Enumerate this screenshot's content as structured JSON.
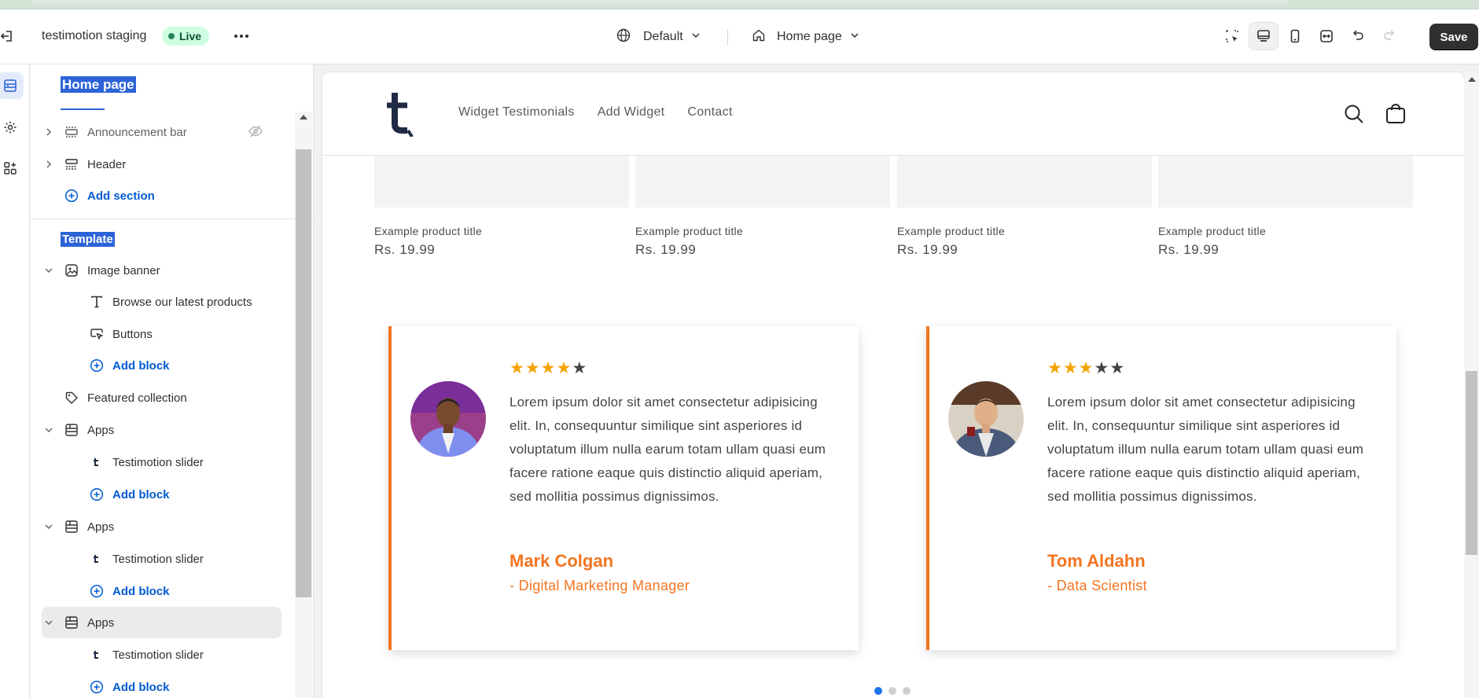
{
  "topbar": {
    "store_name": "testimotion staging",
    "status_badge": "Live",
    "theme_selector": "Default",
    "page_selector": "Home page",
    "save_label": "Save"
  },
  "sidebar": {
    "title": "Home page",
    "header_group": {
      "items": [
        {
          "label": "Announcement bar",
          "icon": "section-icon",
          "hidden": true
        },
        {
          "label": "Header",
          "icon": "section-icon"
        }
      ],
      "add_section": "Add section"
    },
    "template_label": "Template",
    "sections": [
      {
        "label": "Image banner",
        "icon": "image-icon",
        "blocks": [
          {
            "label": "Browse our latest products",
            "icon": "text-icon"
          },
          {
            "label": "Buttons",
            "icon": "button-icon"
          }
        ],
        "add_block": "Add block"
      },
      {
        "label": "Featured collection",
        "icon": "tag-icon"
      },
      {
        "label": "Apps",
        "icon": "apps-icon",
        "blocks": [
          {
            "label": "Testimotion slider",
            "icon": "app-logo-icon"
          }
        ],
        "add_block": "Add block"
      },
      {
        "label": "Apps",
        "icon": "apps-icon",
        "blocks": [
          {
            "label": "Testimotion slider",
            "icon": "app-logo-icon"
          }
        ],
        "add_block": "Add block"
      },
      {
        "label": "Apps",
        "icon": "apps-icon",
        "blocks": [
          {
            "label": "Testimotion slider",
            "icon": "app-logo-icon"
          }
        ],
        "add_block": "Add block"
      }
    ]
  },
  "preview": {
    "nav": [
      "Widget Testimonials",
      "Add Widget",
      "Contact"
    ],
    "products": [
      {
        "title": "Example product title",
        "price": "Rs. 19.99"
      },
      {
        "title": "Example product title",
        "price": "Rs. 19.99"
      },
      {
        "title": "Example product title",
        "price": "Rs. 19.99"
      },
      {
        "title": "Example product title",
        "price": "Rs. 19.99"
      }
    ],
    "testimonials": [
      {
        "rating": 4,
        "max_rating": 5,
        "quote": "Lorem ipsum dolor sit amet consectetur adipisicing elit. In, consequuntur similique sint asperiores id voluptatum illum nulla earum totam ullam quasi eum facere ratione eaque quis distinctio aliquid aperiam, sed mollitia possimus dignissimos.",
        "name": "Mark Colgan",
        "role": "- Digital Marketing Manager"
      },
      {
        "rating": 3,
        "max_rating": 5,
        "quote": "Lorem ipsum dolor sit amet consectetur adipisicing elit. In, consequuntur similique sint asperiores id voluptatum illum nulla earum totam ullam quasi eum facere ratione eaque quis distinctio aliquid aperiam, sed mollitia possimus dignissimos.",
        "name": "Tom Aldahn",
        "role": "- Data Scientist"
      }
    ],
    "slider_pages": 3,
    "slider_active": 1
  },
  "colors": {
    "accent": "#f37521",
    "star_on": "#f4a300",
    "star_off": "#444444",
    "live_badge_bg": "#cdfee1",
    "link_blue": "#005bd3"
  }
}
